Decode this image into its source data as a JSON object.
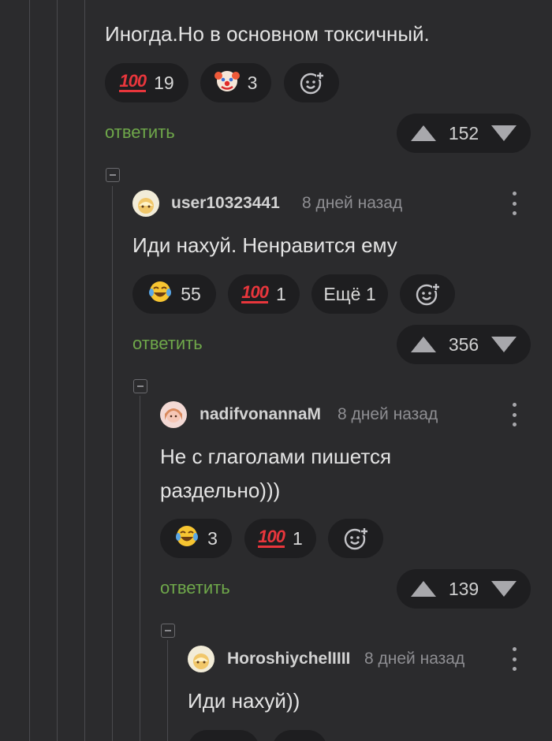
{
  "colors": {
    "background": "#2b2b2d",
    "pill": "#1e1e20",
    "reply_green": "#6fa84a",
    "hundred_red": "#e8363c"
  },
  "comments": [
    {
      "text": "Иногда.Но в основном токсичный.",
      "reactions": [
        {
          "icon": "hundred-points-icon",
          "count": "19"
        },
        {
          "icon": "clown-face-icon",
          "count": "3"
        }
      ],
      "reply_label": "ответить",
      "rating": "152"
    },
    {
      "author": "user10323441",
      "time": "8 дней назад",
      "text": "Иди нахуй. Ненравится ему",
      "reactions": [
        {
          "icon": "tears-of-joy-icon",
          "count": "55"
        },
        {
          "icon": "hundred-points-icon",
          "count": "1"
        }
      ],
      "more_label": "Ещё 1",
      "reply_label": "ответить",
      "rating": "356"
    },
    {
      "author": "nadifvonannaM",
      "time": "8 дней назад",
      "text": "Не с глаголами пишется раздельно)))",
      "reactions": [
        {
          "icon": "tears-of-joy-icon",
          "count": "3"
        },
        {
          "icon": "hundred-points-icon",
          "count": "1"
        }
      ],
      "reply_label": "ответить",
      "rating": "139"
    },
    {
      "author": "HoroshiychelIIII",
      "time": "8 дней назад",
      "text": "Иди нахуй))"
    }
  ]
}
